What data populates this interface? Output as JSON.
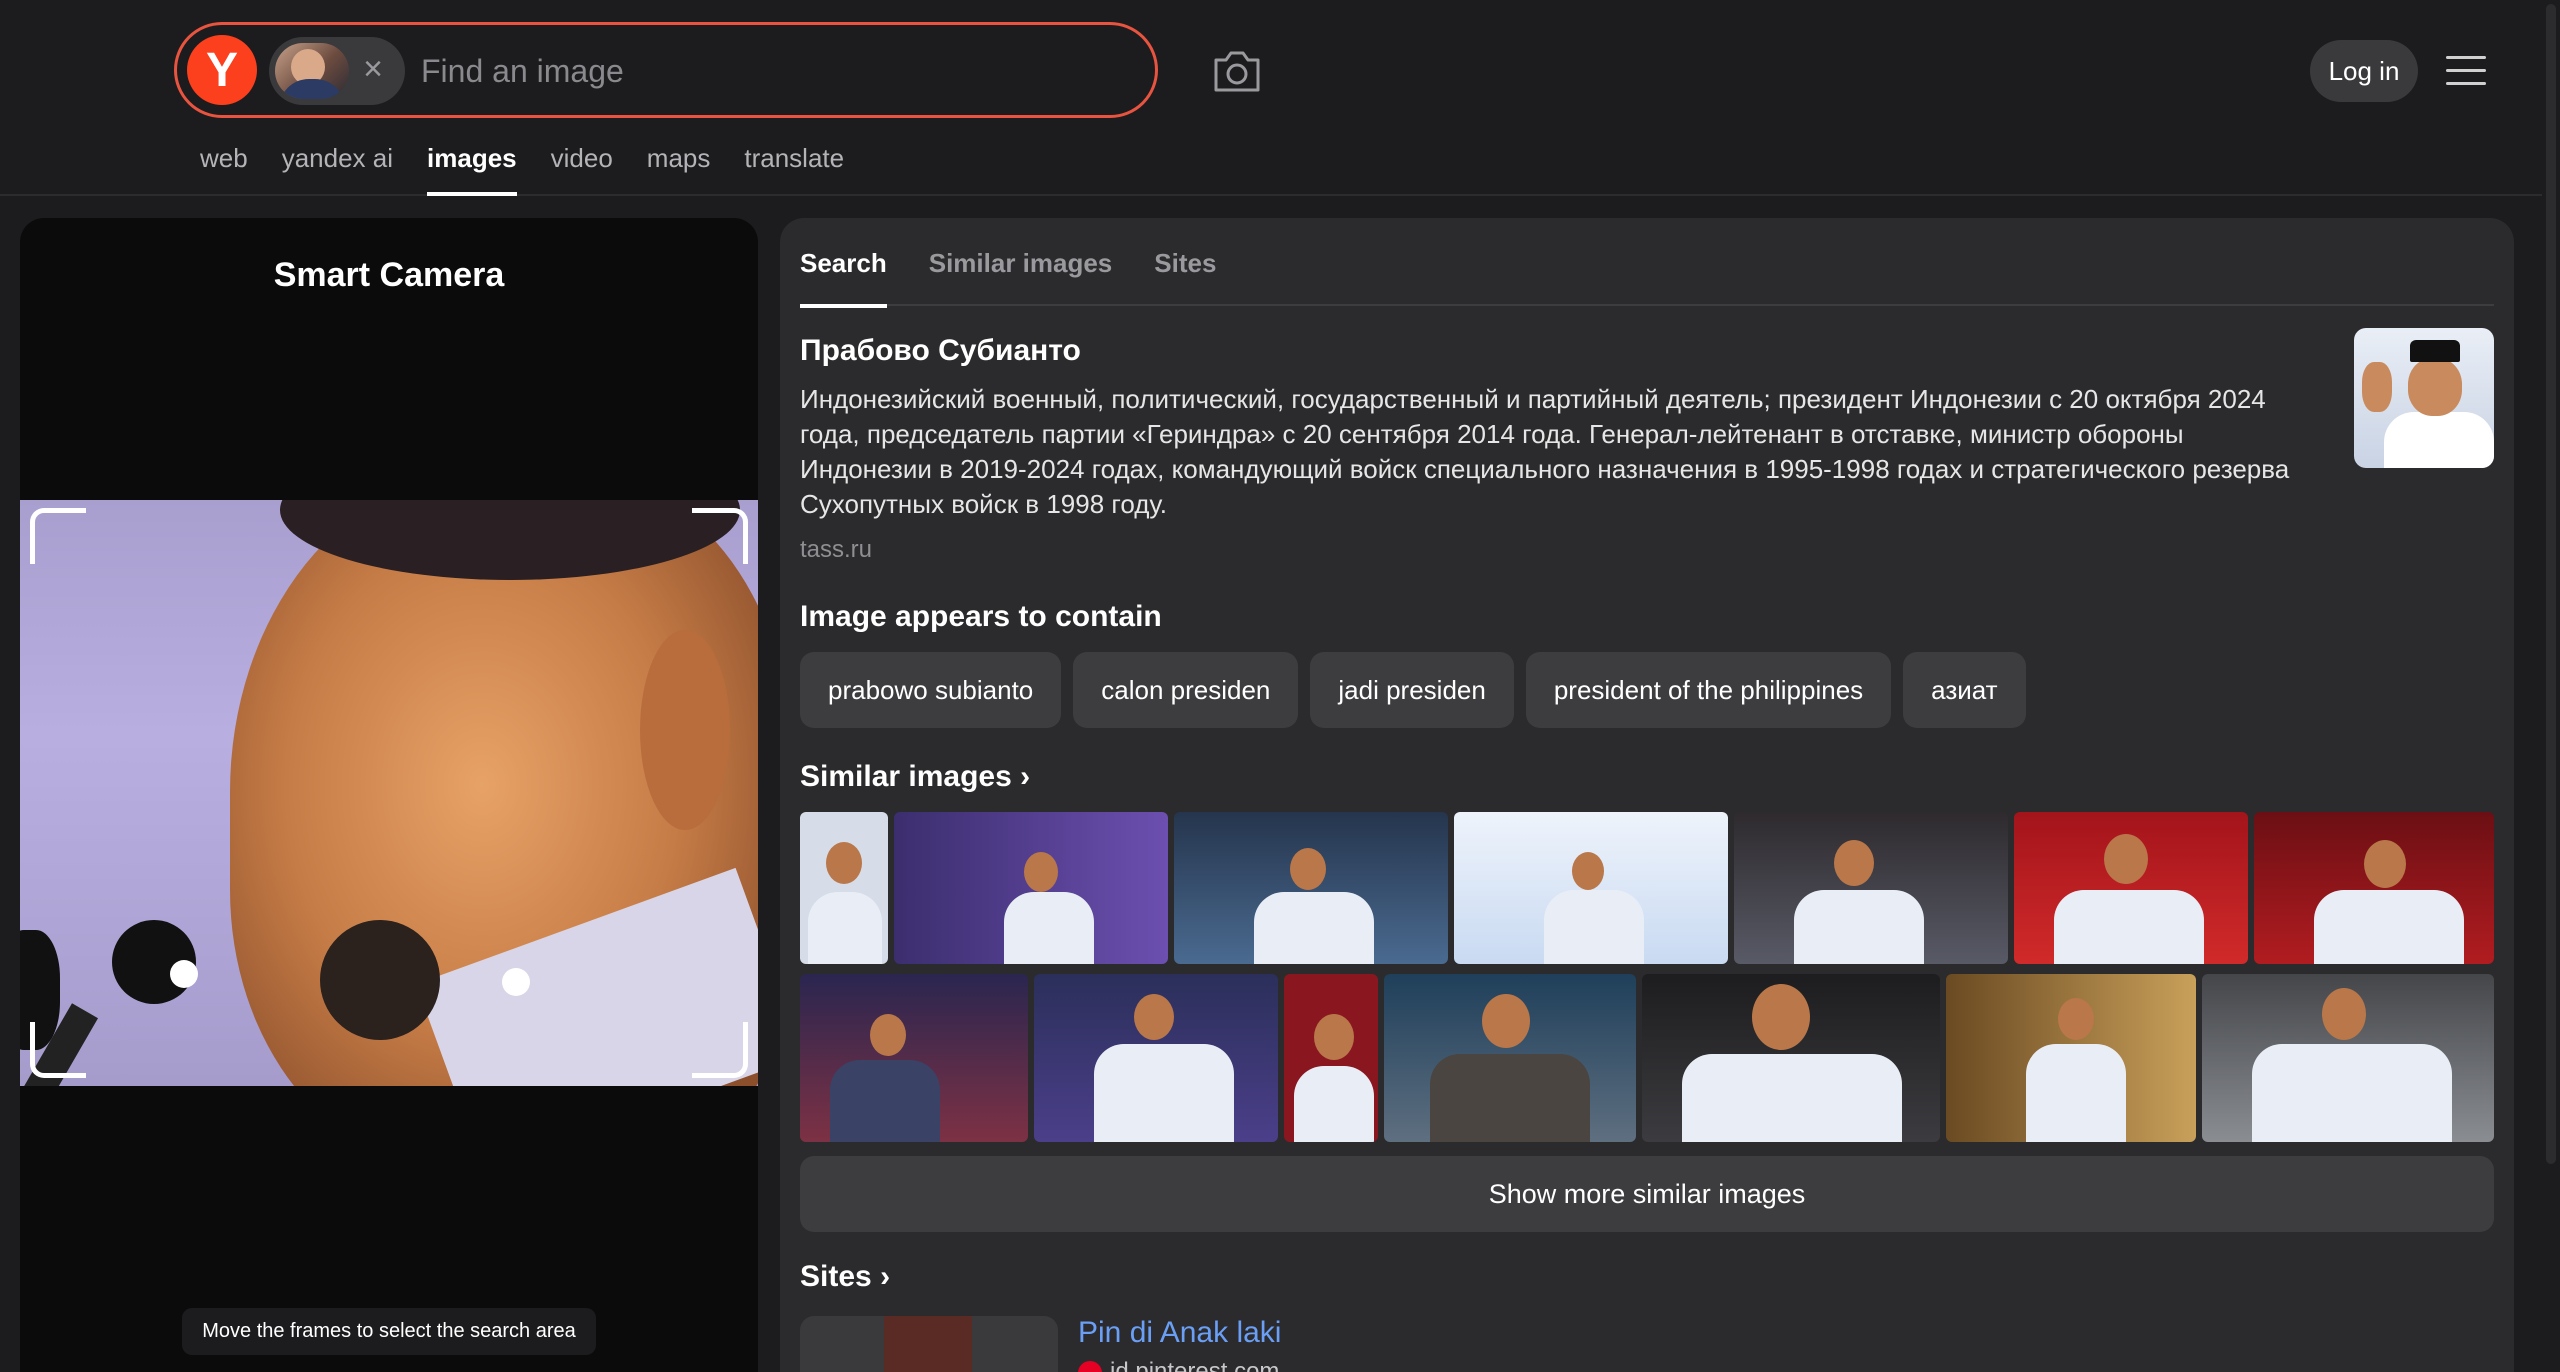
{
  "header": {
    "logo_letter": "Y",
    "search_placeholder": "Find an image",
    "login_label": "Log in",
    "nav": [
      "web",
      "yandex ai",
      "images",
      "video",
      "maps",
      "translate"
    ],
    "nav_active": "images",
    "accent_color": "#fc3f1d"
  },
  "left_panel": {
    "title": "Smart Camera",
    "hint": "Move the frames to select the search area"
  },
  "right_panel": {
    "tabs": [
      "Search",
      "Similar images",
      "Sites"
    ],
    "active_tab": "Search",
    "entity": {
      "name": "Прабово Субианто",
      "description": "Индонезийский военный, политический, государственный и партийный деятель; президент Индонезии с 20 октября 2024 года, председатель партии «Гериндра» с 20 сентября 2014 года. Генерал-лейтенант в отставке, министр обороны Индонезии в 2019-2024 годах, командующий войск специального назначения в 1995-1998 годах и стратегического резерва Сухопутных войск в 1998 году.",
      "source": "tass.ru"
    },
    "contains_title": "Image appears to contain",
    "tags": [
      "prabowo subianto",
      "calon presiden",
      "jadi presiden",
      "president of the philippines",
      "азиат"
    ],
    "similar_title": "Similar images",
    "show_more_label": "Show more similar images",
    "sites_title": "Sites",
    "site_result": {
      "title": "Pin di Anak laki",
      "domain": "id.pinterest.com"
    }
  }
}
